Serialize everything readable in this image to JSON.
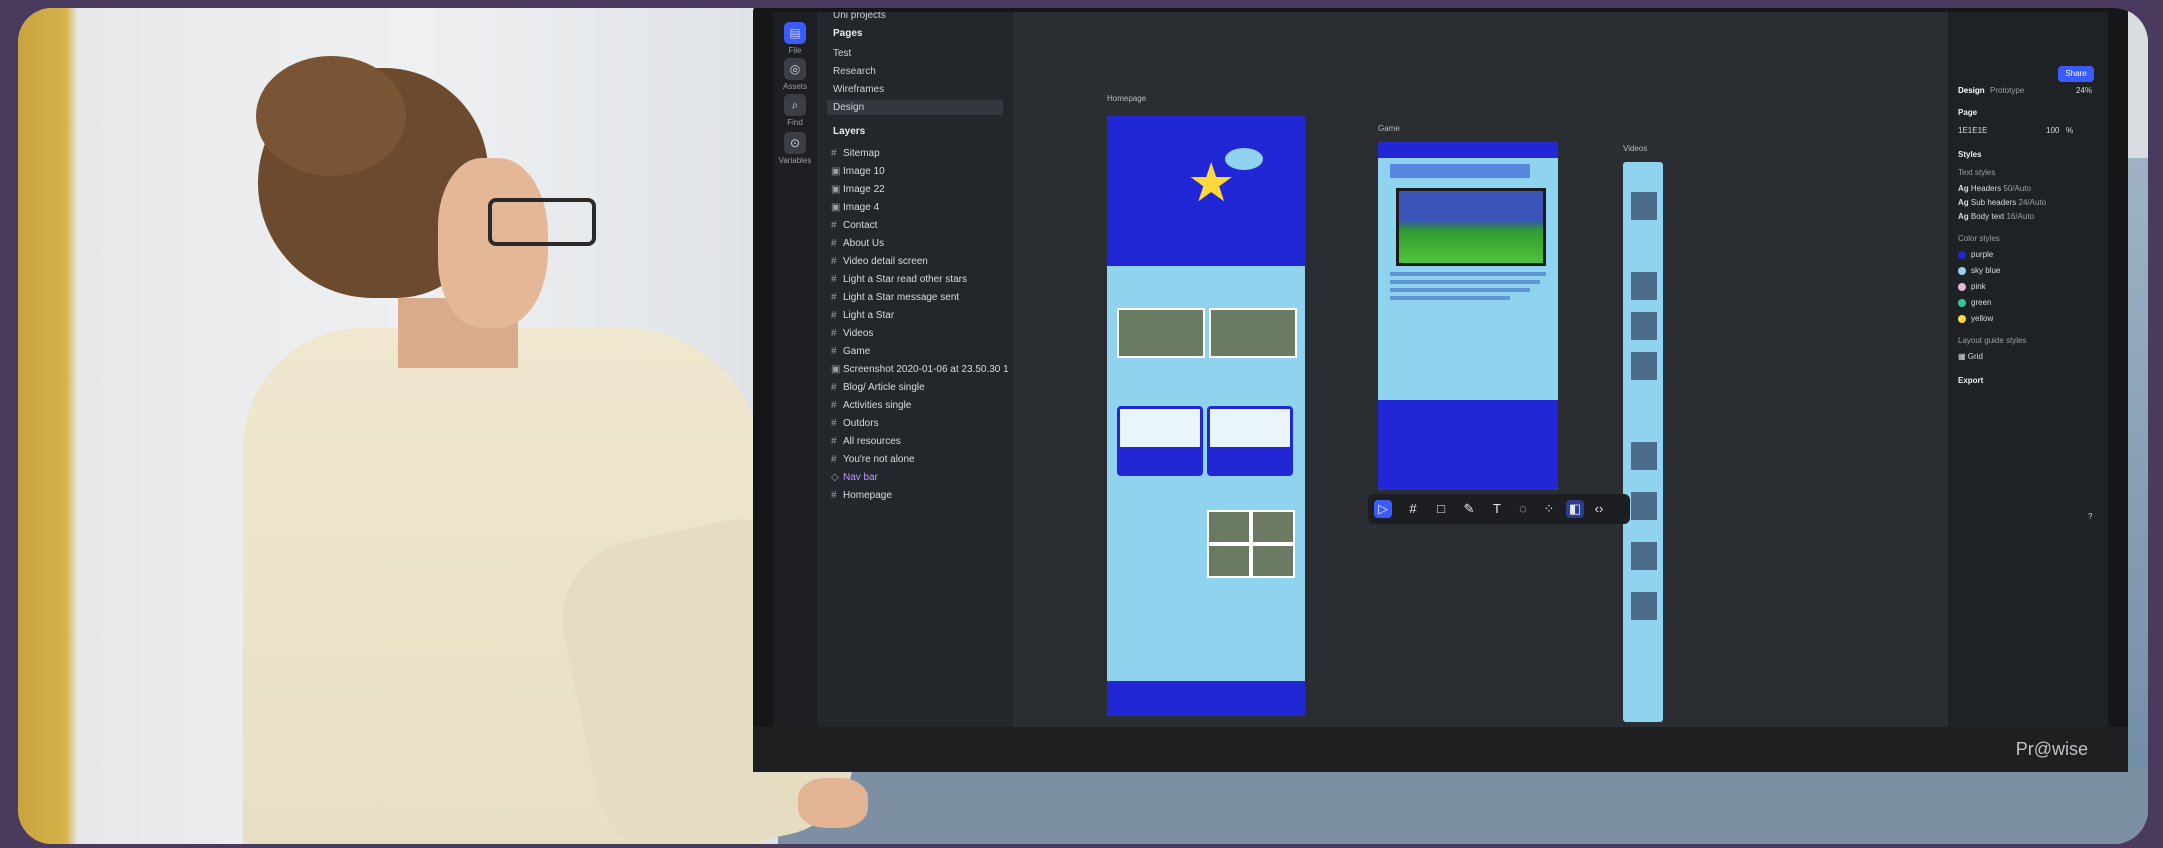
{
  "monitor_brand": "Pr@wise",
  "app": {
    "rail": [
      {
        "label": "File",
        "icon": "file-icon"
      },
      {
        "label": "Assets",
        "icon": "assets-icon"
      },
      {
        "label": "Find",
        "icon": "search-icon"
      },
      {
        "label": "Variables",
        "icon": "variables-icon"
      }
    ],
    "project": "Uni projects",
    "pages_header": "Pages",
    "pages": [
      "Test",
      "Research",
      "Wireframes",
      "Design"
    ],
    "selected_page": "Design",
    "layers_header": "Layers",
    "layers": [
      "Sitemap",
      "Image 10",
      "Image 22",
      "Image 4",
      "Contact",
      "About Us",
      "Video detail screen",
      "Light a Star read other stars",
      "Light a Star message sent",
      "Light a Star",
      "Videos",
      "Game",
      "Screenshot 2020-01-06 at 23.50.30 1",
      "Blog/ Article single",
      "Activities single",
      "Outdors",
      "All resources",
      "You're not alone",
      "Nav bar",
      "Homepage"
    ],
    "frame_labels": {
      "homepage": "Homepage",
      "game": "Game",
      "videos": "Videos"
    },
    "props": {
      "tabs": [
        "Design",
        "Prototype"
      ],
      "share": "Share",
      "zoom": "24%",
      "page_label": "Page",
      "page_color": "1E1E1E",
      "page_opacity": "100",
      "page_percent": "%",
      "styles": "Styles",
      "text_styles": "Text styles",
      "text_items": [
        {
          "name": "Headers",
          "spec": "50/Auto"
        },
        {
          "name": "Sub headers",
          "spec": "24/Auto"
        },
        {
          "name": "Body text",
          "spec": "16/Auto"
        }
      ],
      "color_styles": "Color styles",
      "colors": [
        {
          "name": "purple",
          "hex": "#2227d6"
        },
        {
          "name": "sky blue",
          "hex": "#8fd3ee"
        },
        {
          "name": "pink",
          "hex": "#e9b6d9"
        },
        {
          "name": "green",
          "hex": "#35c6a0"
        },
        {
          "name": "yellow",
          "hex": "#ffd93b"
        }
      ],
      "layout_grid": "Layout guide styles",
      "grid": "Grid",
      "export": "Export",
      "help": "?"
    }
  }
}
